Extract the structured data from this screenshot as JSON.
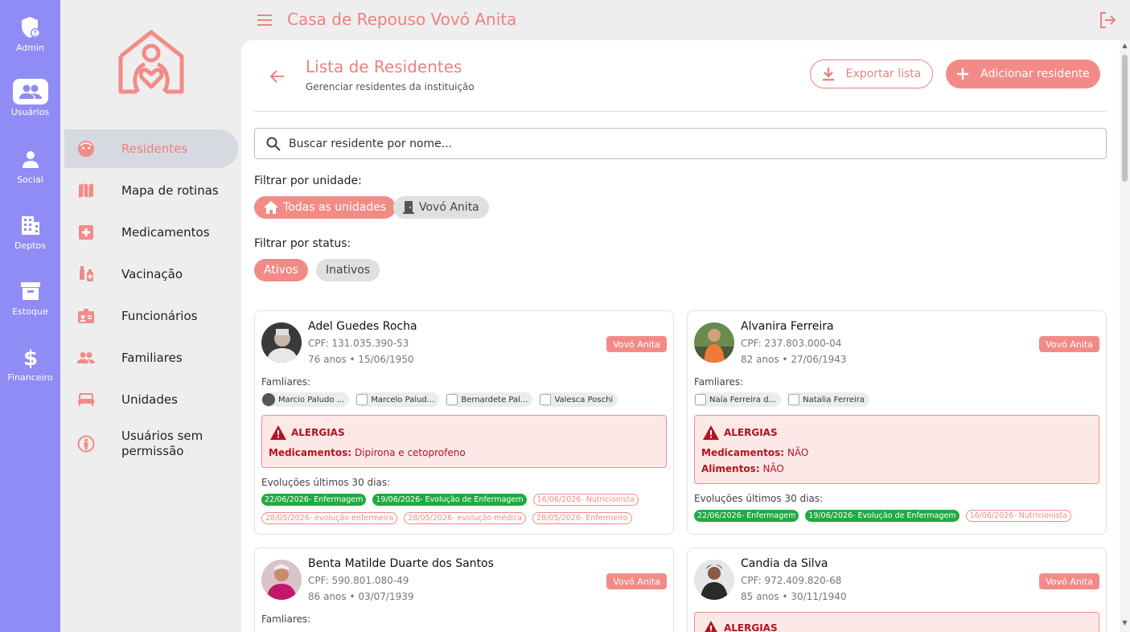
{
  "rail": {
    "items": [
      {
        "label": "Admin",
        "icon": "admin-shield-icon"
      },
      {
        "label": "Usuários",
        "icon": "users-icon",
        "active": true
      },
      {
        "label": "Social",
        "icon": "person-icon"
      },
      {
        "label": "Deptos",
        "icon": "building-icon"
      },
      {
        "label": "Estoque",
        "icon": "archive-icon"
      },
      {
        "label": "Financeiro",
        "icon": "dollar-icon"
      }
    ]
  },
  "nav": {
    "items": [
      {
        "label": "Residentes",
        "icon": "face-icon",
        "active": true
      },
      {
        "label": "Mapa de rotinas",
        "icon": "map-icon"
      },
      {
        "label": "Medicamentos",
        "icon": "medical-cross-icon"
      },
      {
        "label": "Vacinação",
        "icon": "vaccine-icon"
      },
      {
        "label": "Funcionários",
        "icon": "badge-icon"
      },
      {
        "label": "Familiares",
        "icon": "group-icon"
      },
      {
        "label": "Unidades",
        "icon": "bed-icon"
      },
      {
        "label": "Usuários sem permissão",
        "icon": "restricted-person-icon"
      }
    ]
  },
  "header": {
    "title": "Casa de Repouso Vovó Anita"
  },
  "page": {
    "title": "Lista de Residentes",
    "subtitle": "Gerenciar residentes da instituição",
    "export_label": "Exportar lista",
    "add_label": "Adicionar residente"
  },
  "search": {
    "placeholder": "Buscar residente por nome..."
  },
  "filters": {
    "unit_label": "Filtrar por unidade:",
    "units": [
      {
        "label": "Todas as unidades",
        "selected": true
      },
      {
        "label": "Vovó Anita",
        "selected": false
      }
    ],
    "status_label": "Filtrar por status:",
    "statuses": [
      {
        "label": "Ativos",
        "selected": true
      },
      {
        "label": "Inativos",
        "selected": false
      }
    ]
  },
  "labels": {
    "familiares": "Famliares:",
    "alergias": "ALERGIAS",
    "evolucoes": "Evoluções últimos 30 dias:",
    "medicamentos": "Medicamentos:",
    "alimentos": "Alimentos:"
  },
  "residents": [
    {
      "name": "Adel Guedes Rocha",
      "cpf": "CPF: 131.035.390-53",
      "age": "76 anos • 15/06/1950",
      "unit": "Vovó Anita",
      "family": [
        "Marcio Paludo ...",
        "Marcelo Palud...",
        "Bernardete Pal...",
        "Valesca Poschi"
      ],
      "allergy_meds": "Dipirona e cetoprofeno",
      "evolutions": [
        {
          "text": "22/06/2026- Enfermagem",
          "kind": "green"
        },
        {
          "text": "19/06/2026- Evolução de Enfermagem",
          "kind": "green"
        },
        {
          "text": "16/06/2026- Nutricionista",
          "kind": "red"
        },
        {
          "text": "28/05/2026- evolução enfermeira",
          "kind": "red"
        },
        {
          "text": "28/05/2026- evolução médica",
          "kind": "red"
        },
        {
          "text": "28/05/2026- Enfermeiro",
          "kind": "red"
        }
      ]
    },
    {
      "name": "Alvanira Ferreira",
      "cpf": "CPF: 237.803.000-04",
      "age": "82 anos • 27/06/1943",
      "unit": "Vovó Anita",
      "family": [
        "Naía Ferreira d...",
        "Natalia Ferreira"
      ],
      "allergy_meds": "NÃO",
      "allergy_food": "NÃO",
      "evolutions": [
        {
          "text": "22/06/2026- Enfermagem",
          "kind": "green"
        },
        {
          "text": "19/06/2026- Evolução de Enfermagem",
          "kind": "green"
        },
        {
          "text": "16/06/2026- Nutricionista",
          "kind": "red"
        }
      ]
    },
    {
      "name": "Benta Matilde Duarte dos Santos",
      "cpf": "CPF: 590.801.080-49",
      "age": "86 anos • 03/07/1939",
      "unit": "Vovó Anita"
    },
    {
      "name": "Candia da Silva",
      "cpf": "CPF: 972.409.820-68",
      "age": "85 anos • 30/11/1940",
      "unit": "Vovó Anita"
    }
  ]
}
